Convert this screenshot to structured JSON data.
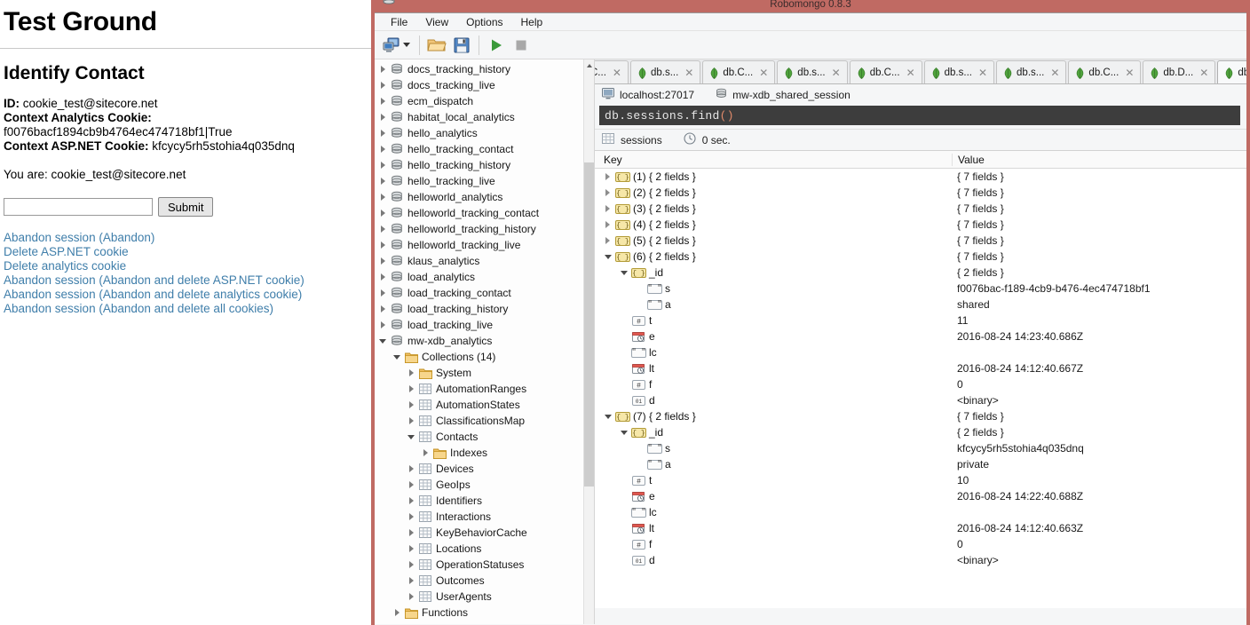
{
  "webpage": {
    "title": "Test Ground",
    "heading": "Identify Contact",
    "id_label": "ID:",
    "id_value": "cookie_test@sitecore.net",
    "analytics_cookie_label": "Context Analytics Cookie:",
    "analytics_cookie_value": "f0076bacf1894cb9b4764ec474718bf1|True",
    "aspnet_cookie_label": "Context ASP.NET Cookie:",
    "aspnet_cookie_value": "kfcycy5rh5stohia4q035dnq",
    "you_are": "You are: cookie_test@sitecore.net",
    "input_value": "",
    "input_placeholder": "",
    "submit_label": "Submit",
    "links": [
      "Abandon session (Abandon)",
      "Delete ASP.NET cookie",
      "Delete analytics cookie",
      "Abandon session (Abandon and delete ASP.NET cookie)",
      "Abandon session (Abandon and delete analytics cookie)",
      "Abandon session (Abandon and delete all cookies)"
    ],
    "link_color": "#3f7eaa"
  },
  "robomongo": {
    "window_title": "Robomongo 0.8.3",
    "titlebar_color": "#c06a63",
    "menu": [
      "File",
      "View",
      "Options",
      "Help"
    ],
    "toolbar": {
      "connect_label": "connect-icon",
      "dropdown_label": "chevron-down-icon",
      "open_label": "open-folder-icon",
      "save_label": "save-icon",
      "execute_label": "execute-icon",
      "stop_label": "stop-icon"
    },
    "tree": [
      {
        "label": "docs_tracking_history",
        "icon": "database-icon",
        "indent": 1,
        "state": "collapsed"
      },
      {
        "label": "docs_tracking_live",
        "icon": "database-icon",
        "indent": 1,
        "state": "collapsed"
      },
      {
        "label": "ecm_dispatch",
        "icon": "database-icon",
        "indent": 1,
        "state": "collapsed"
      },
      {
        "label": "habitat_local_analytics",
        "icon": "database-icon",
        "indent": 1,
        "state": "collapsed"
      },
      {
        "label": "hello_analytics",
        "icon": "database-icon",
        "indent": 1,
        "state": "collapsed"
      },
      {
        "label": "hello_tracking_contact",
        "icon": "database-icon",
        "indent": 1,
        "state": "collapsed"
      },
      {
        "label": "hello_tracking_history",
        "icon": "database-icon",
        "indent": 1,
        "state": "collapsed"
      },
      {
        "label": "hello_tracking_live",
        "icon": "database-icon",
        "indent": 1,
        "state": "collapsed"
      },
      {
        "label": "helloworld_analytics",
        "icon": "database-icon",
        "indent": 1,
        "state": "collapsed"
      },
      {
        "label": "helloworld_tracking_contact",
        "icon": "database-icon",
        "indent": 1,
        "state": "collapsed"
      },
      {
        "label": "helloworld_tracking_history",
        "icon": "database-icon",
        "indent": 1,
        "state": "collapsed"
      },
      {
        "label": "helloworld_tracking_live",
        "icon": "database-icon",
        "indent": 1,
        "state": "collapsed"
      },
      {
        "label": "klaus_analytics",
        "icon": "database-icon",
        "indent": 1,
        "state": "collapsed"
      },
      {
        "label": "load_analytics",
        "icon": "database-icon",
        "indent": 1,
        "state": "collapsed"
      },
      {
        "label": "load_tracking_contact",
        "icon": "database-icon",
        "indent": 1,
        "state": "collapsed"
      },
      {
        "label": "load_tracking_history",
        "icon": "database-icon",
        "indent": 1,
        "state": "collapsed"
      },
      {
        "label": "load_tracking_live",
        "icon": "database-icon",
        "indent": 1,
        "state": "collapsed"
      },
      {
        "label": "mw-xdb_analytics",
        "icon": "database-icon",
        "indent": 1,
        "state": "expanded"
      },
      {
        "label": "Collections (14)",
        "icon": "folder-icon",
        "indent": 2,
        "state": "expanded"
      },
      {
        "label": "System",
        "icon": "folder-icon",
        "indent": 3,
        "state": "collapsed"
      },
      {
        "label": "AutomationRanges",
        "icon": "collection-icon",
        "indent": 3,
        "state": "collapsed"
      },
      {
        "label": "AutomationStates",
        "icon": "collection-icon",
        "indent": 3,
        "state": "collapsed"
      },
      {
        "label": "ClassificationsMap",
        "icon": "collection-icon",
        "indent": 3,
        "state": "collapsed"
      },
      {
        "label": "Contacts",
        "icon": "collection-icon",
        "indent": 3,
        "state": "expanded"
      },
      {
        "label": "Indexes",
        "icon": "folder-icon",
        "indent": 4,
        "state": "collapsed"
      },
      {
        "label": "Devices",
        "icon": "collection-icon",
        "indent": 3,
        "state": "collapsed"
      },
      {
        "label": "GeoIps",
        "icon": "collection-icon",
        "indent": 3,
        "state": "collapsed"
      },
      {
        "label": "Identifiers",
        "icon": "collection-icon",
        "indent": 3,
        "state": "collapsed"
      },
      {
        "label": "Interactions",
        "icon": "collection-icon",
        "indent": 3,
        "state": "collapsed"
      },
      {
        "label": "KeyBehaviorCache",
        "icon": "collection-icon",
        "indent": 3,
        "state": "collapsed"
      },
      {
        "label": "Locations",
        "icon": "collection-icon",
        "indent": 3,
        "state": "collapsed"
      },
      {
        "label": "OperationStatuses",
        "icon": "collection-icon",
        "indent": 3,
        "state": "collapsed"
      },
      {
        "label": "Outcomes",
        "icon": "collection-icon",
        "indent": 3,
        "state": "collapsed"
      },
      {
        "label": "UserAgents",
        "icon": "collection-icon",
        "indent": 3,
        "state": "collapsed"
      },
      {
        "label": "Functions",
        "icon": "folder-icon",
        "indent": 2,
        "state": "collapsed"
      }
    ],
    "tabs": [
      {
        "label": "C...",
        "active": false,
        "icon": "mongo-leaf-icon"
      },
      {
        "label": "db.s...",
        "active": false,
        "icon": "mongo-leaf-icon"
      },
      {
        "label": "db.C...",
        "active": false,
        "icon": "mongo-leaf-icon"
      },
      {
        "label": "db.s...",
        "active": false,
        "icon": "mongo-leaf-icon"
      },
      {
        "label": "db.C...",
        "active": false,
        "icon": "mongo-leaf-icon"
      },
      {
        "label": "db.s...",
        "active": false,
        "icon": "mongo-leaf-icon"
      },
      {
        "label": "db.s...",
        "active": false,
        "icon": "mongo-leaf-icon"
      },
      {
        "label": "db.C...",
        "active": false,
        "icon": "mongo-leaf-icon"
      },
      {
        "label": "db.D...",
        "active": false,
        "icon": "mongo-leaf-icon"
      },
      {
        "label": "db.s...",
        "active": true,
        "icon": "mongo-leaf-icon"
      }
    ],
    "connection": {
      "server": "localhost:27017",
      "database": "mw-xdb_shared_session"
    },
    "query": "db.sessions.find",
    "query_parens": "()",
    "status": {
      "collection": "sessions",
      "time": "0 sec."
    },
    "grid": {
      "columns": {
        "key": "Key",
        "value": "Value"
      },
      "rows": [
        {
          "key": "(1) { 2 fields }",
          "value": "{ 7 fields }",
          "icon": "object-icon",
          "indent": 0,
          "state": "collapsed"
        },
        {
          "key": "(2) { 2 fields }",
          "value": "{ 7 fields }",
          "icon": "object-icon",
          "indent": 0,
          "state": "collapsed"
        },
        {
          "key": "(3) { 2 fields }",
          "value": "{ 7 fields }",
          "icon": "object-icon",
          "indent": 0,
          "state": "collapsed"
        },
        {
          "key": "(4) { 2 fields }",
          "value": "{ 7 fields }",
          "icon": "object-icon",
          "indent": 0,
          "state": "collapsed"
        },
        {
          "key": "(5) { 2 fields }",
          "value": "{ 7 fields }",
          "icon": "object-icon",
          "indent": 0,
          "state": "collapsed"
        },
        {
          "key": "(6) { 2 fields }",
          "value": "{ 7 fields }",
          "icon": "object-icon",
          "indent": 0,
          "state": "expanded"
        },
        {
          "key": "_id",
          "value": "{ 2 fields }",
          "icon": "object-icon",
          "indent": 1,
          "state": "expanded"
        },
        {
          "key": "s",
          "value": "f0076bac-f189-4cb9-b476-4ec474718bf1",
          "icon": "string-icon",
          "indent": 2,
          "state": "leaf"
        },
        {
          "key": "a",
          "value": "shared",
          "icon": "string-icon",
          "indent": 2,
          "state": "leaf"
        },
        {
          "key": "t",
          "value": "11",
          "icon": "number-icon",
          "indent": 1,
          "state": "leaf"
        },
        {
          "key": "e",
          "value": "2016-08-24 14:23:40.686Z",
          "icon": "date-icon",
          "indent": 1,
          "state": "leaf"
        },
        {
          "key": "lc",
          "value": "",
          "icon": "string-icon",
          "indent": 1,
          "state": "leaf"
        },
        {
          "key": "lt",
          "value": "2016-08-24 14:12:40.667Z",
          "icon": "date-icon",
          "indent": 1,
          "state": "leaf"
        },
        {
          "key": "f",
          "value": "0",
          "icon": "number-icon",
          "indent": 1,
          "state": "leaf"
        },
        {
          "key": "d",
          "value": "<binary>",
          "icon": "binary-icon",
          "indent": 1,
          "state": "leaf"
        },
        {
          "key": "(7) { 2 fields }",
          "value": "{ 7 fields }",
          "icon": "object-icon",
          "indent": 0,
          "state": "expanded"
        },
        {
          "key": "_id",
          "value": "{ 2 fields }",
          "icon": "object-icon",
          "indent": 1,
          "state": "expanded"
        },
        {
          "key": "s",
          "value": "kfcycy5rh5stohia4q035dnq",
          "icon": "string-icon",
          "indent": 2,
          "state": "leaf"
        },
        {
          "key": "a",
          "value": "private",
          "icon": "string-icon",
          "indent": 2,
          "state": "leaf"
        },
        {
          "key": "t",
          "value": "10",
          "icon": "number-icon",
          "indent": 1,
          "state": "leaf"
        },
        {
          "key": "e",
          "value": "2016-08-24 14:22:40.688Z",
          "icon": "date-icon",
          "indent": 1,
          "state": "leaf"
        },
        {
          "key": "lc",
          "value": "",
          "icon": "string-icon",
          "indent": 1,
          "state": "leaf"
        },
        {
          "key": "lt",
          "value": "2016-08-24 14:12:40.663Z",
          "icon": "date-icon",
          "indent": 1,
          "state": "leaf"
        },
        {
          "key": "f",
          "value": "0",
          "icon": "number-icon",
          "indent": 1,
          "state": "leaf"
        },
        {
          "key": "d",
          "value": "<binary>",
          "icon": "binary-icon",
          "indent": 1,
          "state": "leaf"
        }
      ]
    }
  }
}
